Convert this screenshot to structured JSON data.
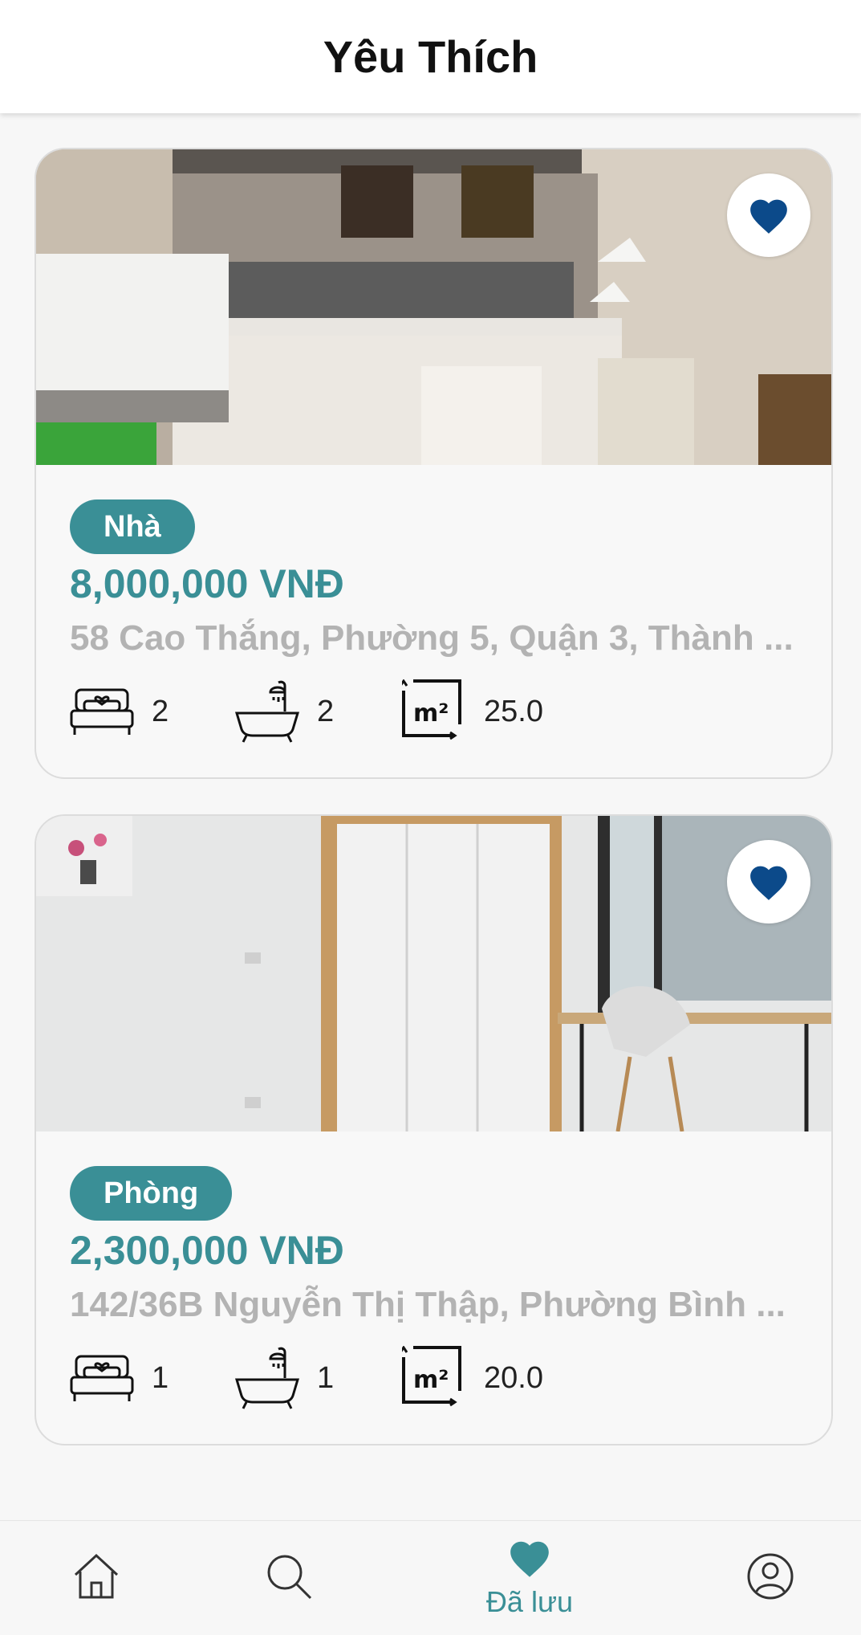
{
  "header": {
    "title": "Yêu Thích"
  },
  "colors": {
    "accent": "#3a8f96",
    "heart": "#0c4a8a",
    "muted": "#b3b3b3"
  },
  "listings": [
    {
      "type_label": "Nhà",
      "price": "8,000,000 VNĐ",
      "address": "58  Cao Thắng, Phường 5, Quận 3, Thành ...",
      "bedrooms": "2",
      "bathrooms": "2",
      "area": "25.0",
      "favorite_icon": "heart-icon"
    },
    {
      "type_label": "Phòng",
      "price": "2,300,000 VNĐ",
      "address": "142/36B Nguyễn Thị Thập, Phường Bình ...",
      "bedrooms": "1",
      "bathrooms": "1",
      "area": "20.0",
      "favorite_icon": "heart-icon"
    }
  ],
  "bottom_nav": {
    "items": [
      {
        "icon": "home-icon",
        "label": ""
      },
      {
        "icon": "search-icon",
        "label": ""
      },
      {
        "icon": "heart-icon",
        "label": "Đã lưu",
        "active": true
      },
      {
        "icon": "profile-icon",
        "label": ""
      }
    ]
  }
}
